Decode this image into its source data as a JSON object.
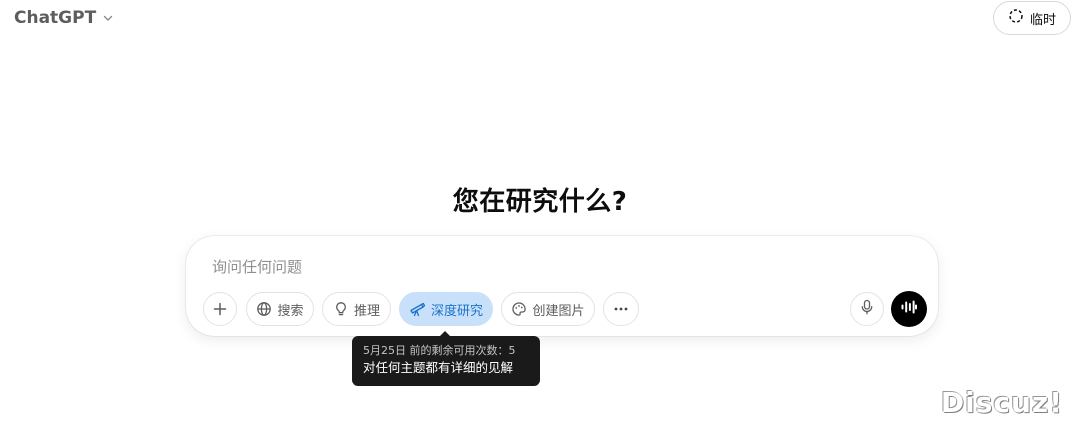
{
  "header": {
    "model_name": "ChatGPT",
    "temporary_label": "临时"
  },
  "main": {
    "headline": "您在研究什么?"
  },
  "composer": {
    "placeholder": "询问任何问题",
    "tools": [
      {
        "icon": "plus-icon",
        "label": ""
      },
      {
        "icon": "globe-icon",
        "label": "搜索"
      },
      {
        "icon": "lightbulb-icon",
        "label": "推理"
      },
      {
        "icon": "telescope-icon",
        "label": "深度研究",
        "active": true
      },
      {
        "icon": "palette-icon",
        "label": "创建图片"
      },
      {
        "icon": "more-icon",
        "label": ""
      }
    ],
    "mic_icon": "microphone-icon",
    "voice_icon": "voice-mode-icon"
  },
  "tooltip": {
    "line1": "5月25日 前的剩余可用次数：5",
    "line2": "对任何主题都有详细的见解"
  },
  "watermark": "Discuz!",
  "colors": {
    "active_tool_bg": "#c9e0fb",
    "active_tool_text": "#1a73c8",
    "tooltip_bg": "#1a1a1a"
  }
}
